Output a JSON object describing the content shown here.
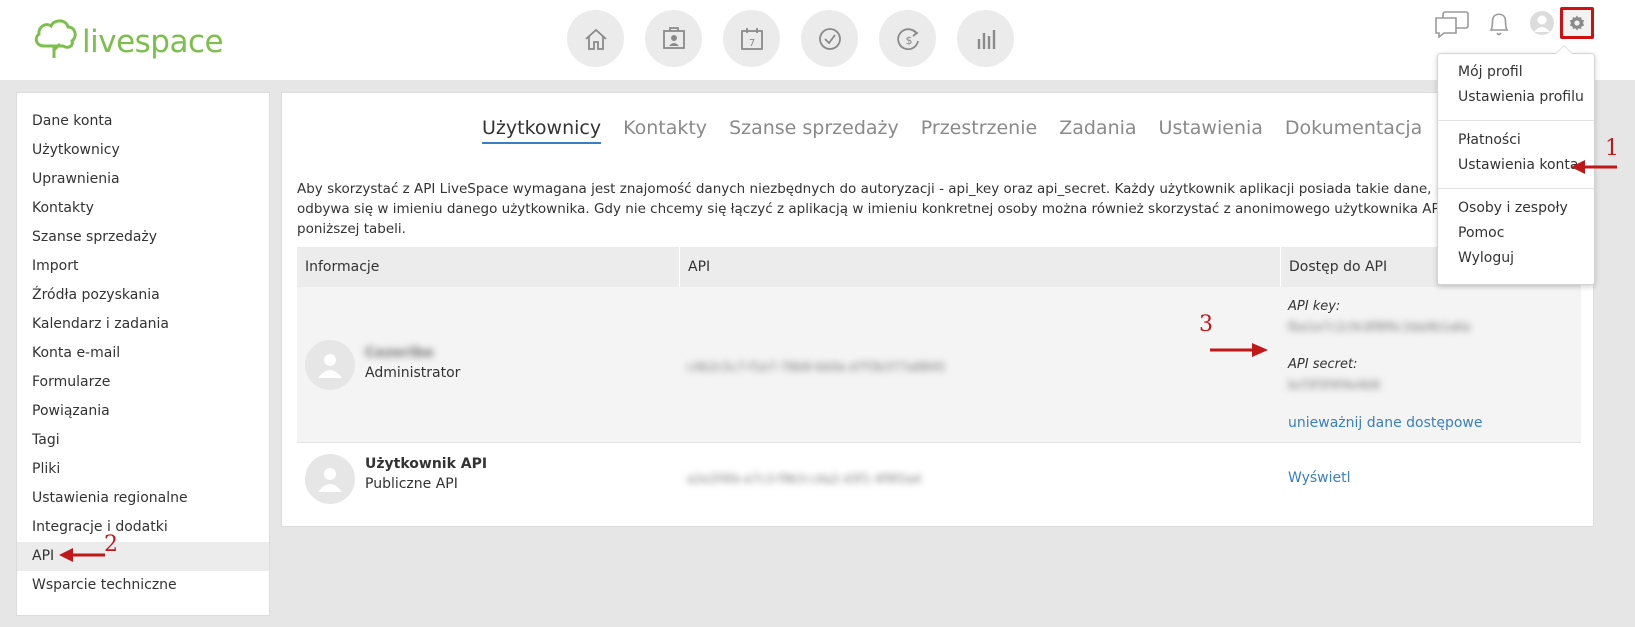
{
  "brand": {
    "name": "livespace",
    "color": "#7cc04b"
  },
  "topnav": {
    "icons": [
      "home-icon",
      "contacts-icon",
      "calendar-icon",
      "tasks-icon",
      "deals-icon",
      "reports-icon"
    ],
    "calendar_day": "7"
  },
  "header_right": {
    "icons": [
      "chat-icon",
      "bell-icon",
      "user-avatar-icon",
      "gear-icon"
    ]
  },
  "sidebar": {
    "items": [
      "Dane konta",
      "Użytkownicy",
      "Uprawnienia",
      "Kontakty",
      "Szanse sprzedaży",
      "Import",
      "Źródła pozyskania",
      "Kalendarz i zadania",
      "Konta e-mail",
      "Formularze",
      "Powiązania",
      "Tagi",
      "Pliki",
      "Ustawienia regionalne",
      "Integracje i dodatki",
      "API",
      "Wsparcie techniczne"
    ],
    "active": "API"
  },
  "tabs": [
    "Użytkownicy",
    "Kontakty",
    "Szanse sprzedaży",
    "Przestrzenie",
    "Zadania",
    "Ustawienia",
    "Dokumentacja"
  ],
  "active_tab": "Użytkownicy",
  "intro": {
    "line1": "Aby skorzystać z API LiveSpace wymagana jest znajomość danych niezbędnych do autoryzacji - api_key oraz api_secret. Każdy użytkownik aplikacji posiada takie dane, po ich podaniu",
    "line2": "odbywa się w imieniu danego użytkownika. Gdy nie chcemy się łączyć z aplikacją w imieniu konkretnej osoby można również skorzystać z anonimowego użytkownika API. Dane dostęp",
    "line3": "poniższej tabeli."
  },
  "table": {
    "headers": [
      "Informacje",
      "API",
      "Dostęp do API"
    ],
    "rows": [
      {
        "name": "Cezeribe",
        "role": "Administrator",
        "api": "c4b2c5c7-f1e7-78b8-bb0e-d7f3b377a8845",
        "api_key_label": "API key:",
        "api_key_value": "fbe1e7c2c9c8f8f6c3da9b1a6e",
        "api_secret_label": "API secret:",
        "api_secret_value": "bcf3f3f4f4e4b8",
        "action": "unieważnij dane dostępowe"
      },
      {
        "name": "Użytkownik API",
        "role": "Publiczne API",
        "api": "a2e2f4fe-e7c3-f9b3-c4a2-d3f1-4f9f2a4",
        "action": "Wyświetl"
      }
    ]
  },
  "dropdown": {
    "items": [
      "Mój profil",
      "Ustawienia profilu",
      "Płatności",
      "Ustawienia konta",
      "Osoby i zespoły",
      "Pomoc",
      "Wyloguj"
    ]
  },
  "annotations": [
    "1",
    "2",
    "3"
  ],
  "colors": {
    "accent": "#3a7fc1",
    "annotation": "#c01818",
    "brand": "#7cc04b"
  }
}
